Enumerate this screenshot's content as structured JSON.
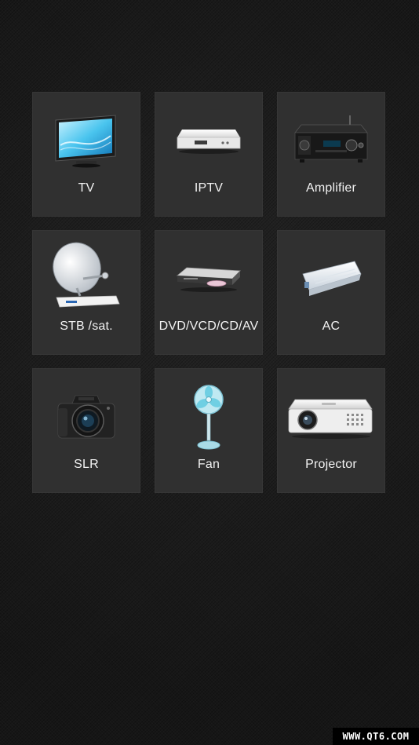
{
  "devices": [
    {
      "label": "TV",
      "icon": "tv-icon"
    },
    {
      "label": "IPTV",
      "icon": "iptv-box-icon"
    },
    {
      "label": "Amplifier",
      "icon": "amplifier-icon"
    },
    {
      "label": "STB /sat.",
      "icon": "satellite-dish-icon"
    },
    {
      "label": "DVD/VCD/CD/AV",
      "icon": "dvd-player-icon"
    },
    {
      "label": "AC",
      "icon": "air-conditioner-icon"
    },
    {
      "label": "SLR",
      "icon": "camera-icon"
    },
    {
      "label": "Fan",
      "icon": "fan-icon"
    },
    {
      "label": "Projector",
      "icon": "projector-icon"
    }
  ],
  "watermark": "WWW.QT6.COM"
}
